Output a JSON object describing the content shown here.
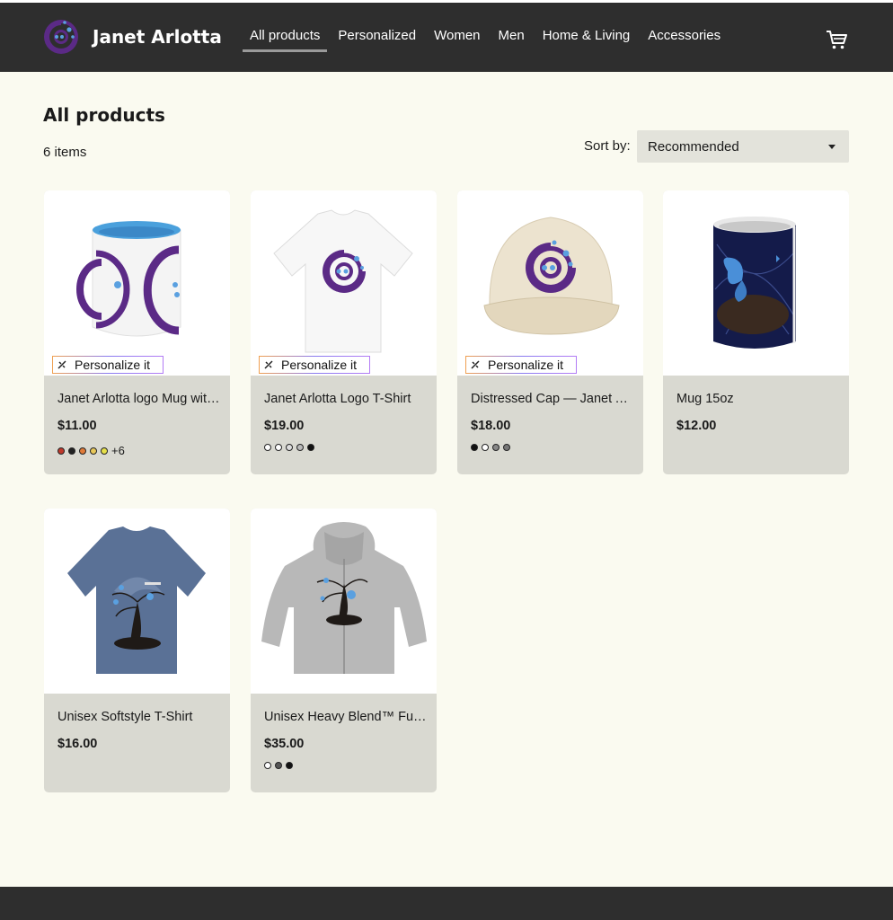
{
  "brand": {
    "name": "Janet Arlotta",
    "logo_icon": "janet-arlotta-logo-icon"
  },
  "nav": {
    "items": [
      {
        "label": "All products",
        "active": true
      },
      {
        "label": "Personalized"
      },
      {
        "label": "Women"
      },
      {
        "label": "Men"
      },
      {
        "label": "Home & Living"
      },
      {
        "label": "Accessories"
      }
    ],
    "cart_icon": "shopping-cart-icon"
  },
  "main": {
    "title": "All products",
    "count": "6 items",
    "sort": {
      "label": "Sort by:",
      "value": "Recommended"
    }
  },
  "personalize_label": "Personalize it",
  "products": [
    {
      "title": "Janet Arlotta logo Mug with Color Inside",
      "price": "$11.00",
      "personalize": true,
      "swatches": [
        "#c0392b",
        "#222222",
        "#e07b39",
        "#e8c85a",
        "#e6e04a"
      ],
      "more": "+6"
    },
    {
      "title": "Janet Arlotta Logo T-Shirt",
      "price": "$19.00",
      "personalize": true,
      "swatches": [
        "#ffffff",
        "#ffffff",
        "#dddddd",
        "#bbbbbb",
        "#111111"
      ]
    },
    {
      "title": "Distressed Cap — Janet Arlotta",
      "price": "$18.00",
      "personalize": true,
      "swatches": [
        "#111111",
        "#ffffff",
        "#888888",
        "#777777"
      ]
    },
    {
      "title": "Mug 15oz",
      "price": "$12.00",
      "personalize": false,
      "swatches": []
    },
    {
      "title": "Unisex Softstyle T-Shirt",
      "price": "$16.00",
      "personalize": false,
      "swatches": []
    },
    {
      "title": "Unisex Heavy Blend™ Full Zip Hooded Sweatshirt",
      "price": "$35.00",
      "personalize": false,
      "swatches": [
        "#ffffff",
        "#555555",
        "#111111"
      ]
    }
  ]
}
